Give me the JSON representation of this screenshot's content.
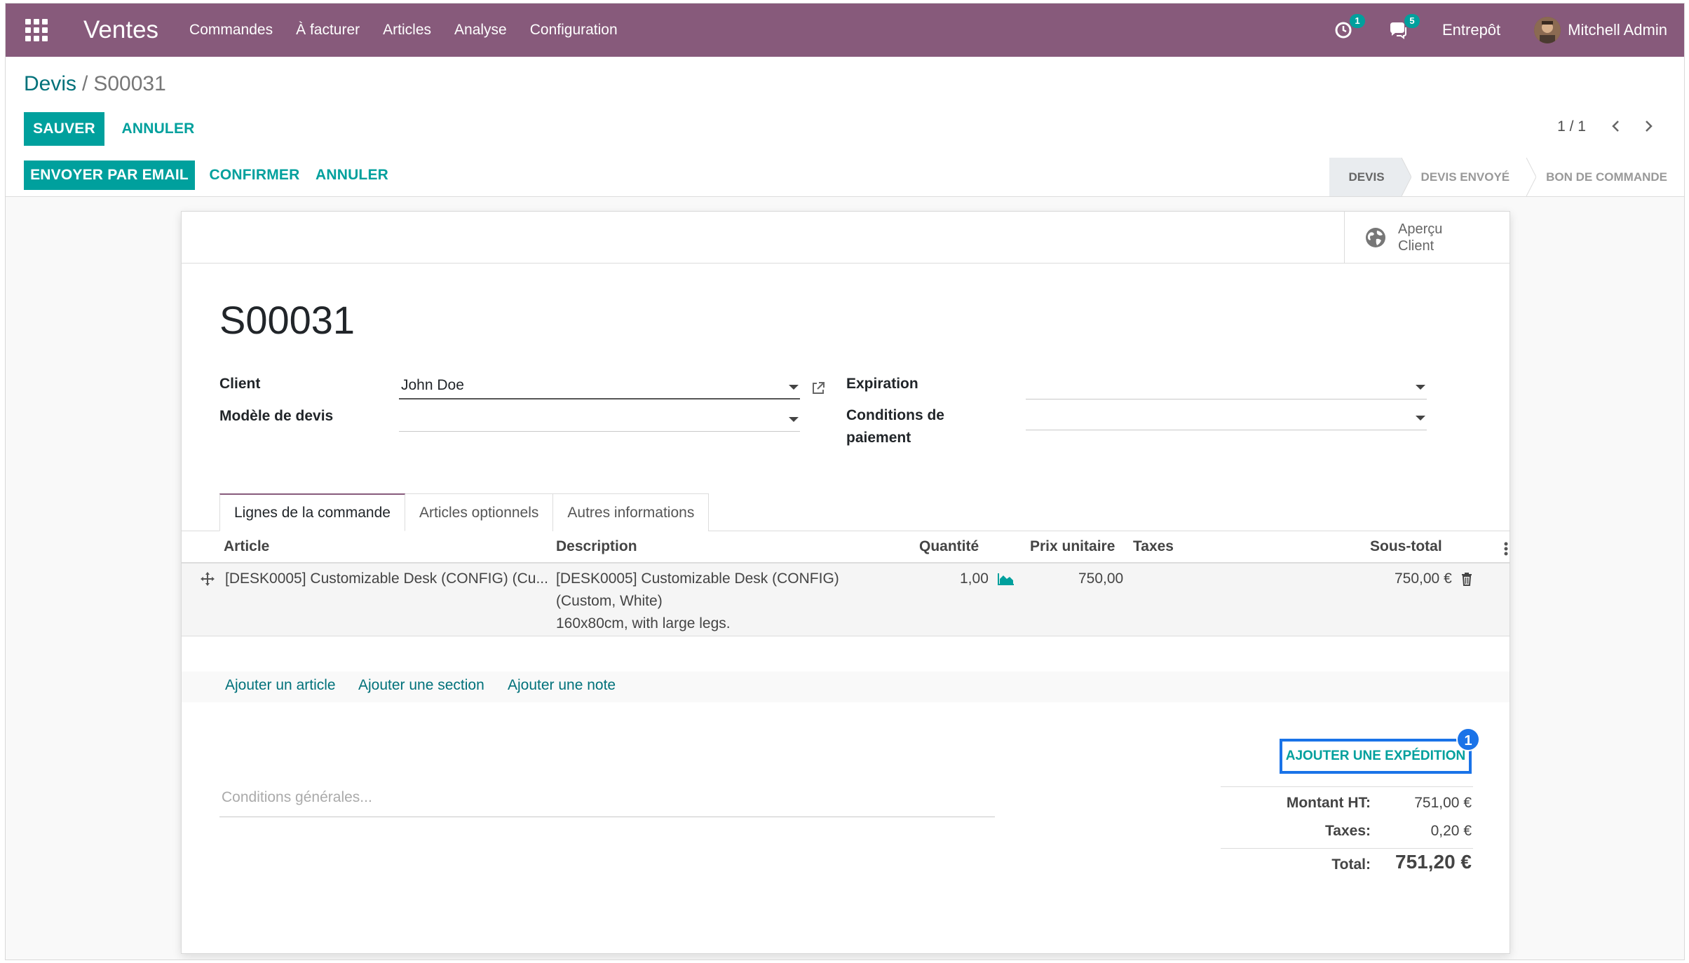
{
  "navbar": {
    "app_name": "Ventes",
    "menu": [
      "Commandes",
      "À facturer",
      "Articles",
      "Analyse",
      "Configuration"
    ],
    "activity_count": "1",
    "message_count": "5",
    "company": "Entrepôt",
    "user_name": "Mitchell Admin",
    "color": "#875a7b"
  },
  "breadcrumb": {
    "parent": "Devis",
    "separator": "/",
    "current": "S00031"
  },
  "actions": {
    "save": "SAUVER",
    "discard": "ANNULER"
  },
  "pager": {
    "value": "1 / 1"
  },
  "status": {
    "buttons": {
      "send_email": "ENVOYER PAR EMAIL",
      "confirm": "CONFIRMER",
      "cancel": "ANNULER"
    },
    "steps": [
      "DEVIS",
      "DEVIS ENVOYÉ",
      "BON DE COMMANDE"
    ],
    "active_step": "DEVIS"
  },
  "form": {
    "preview_line1": "Aperçu",
    "preview_line2": "Client",
    "title": "S00031",
    "client_label": "Client",
    "client_value": "John Doe",
    "template_label": "Modèle de devis",
    "template_value": "",
    "expiration_label": "Expiration",
    "expiration_value": "",
    "payment_terms_label_1": "Conditions de",
    "payment_terms_label_2": "paiement",
    "payment_terms_value": ""
  },
  "tabs": [
    "Lignes de la commande",
    "Articles optionnels",
    "Autres informations"
  ],
  "table": {
    "headers": {
      "article": "Article",
      "description": "Description",
      "quantity": "Quantité",
      "unit_price": "Prix unitaire",
      "taxes": "Taxes",
      "subtotal": "Sous-total"
    },
    "rows": [
      {
        "article": "[DESK0005] Customizable Desk (CONFIG) (Cu...",
        "description_1": "[DESK0005] Customizable Desk (CONFIG)",
        "description_2": "(Custom, White)",
        "description_3": "160x80cm, with large legs.",
        "quantity": "1,00",
        "unit_price": "750,00",
        "taxes": "",
        "subtotal": "750,00 €"
      }
    ],
    "add_links": {
      "article": "Ajouter un article",
      "section": "Ajouter une section",
      "note": "Ajouter une note"
    }
  },
  "footer": {
    "terms_placeholder": "Conditions générales...",
    "add_shipping": "AJOUTER UNE EXPÉDITION",
    "highlight_badge": "1",
    "untaxed_label": "Montant HT:",
    "untaxed_value": "751,00 €",
    "taxes_label": "Taxes:",
    "taxes_value": "0,20 €",
    "total_label": "Total:",
    "total_value": "751,20 €"
  },
  "colors": {
    "primary": "#00a09d",
    "link": "#00717a",
    "highlight": "#1a73e8"
  }
}
